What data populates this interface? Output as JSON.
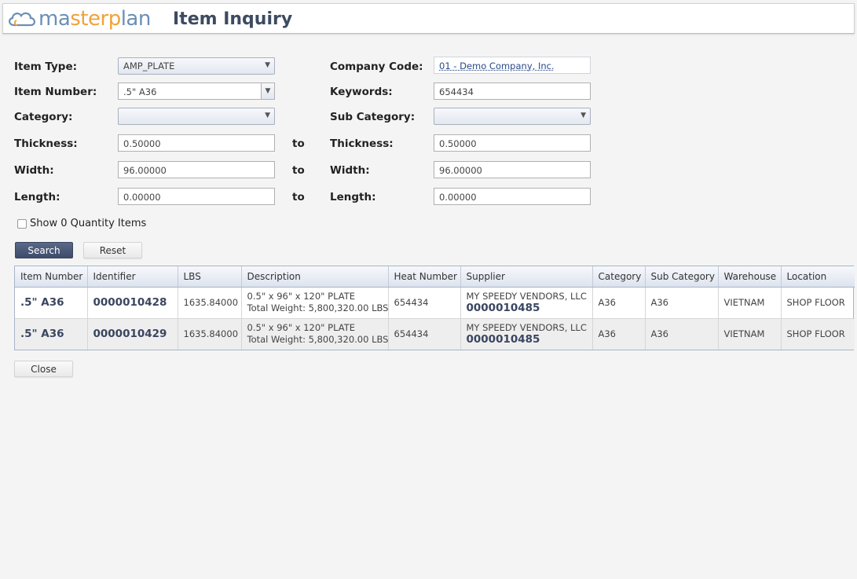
{
  "brand": {
    "logo_part1": "ma",
    "logo_part2": "sterp",
    "logo_part3": "lan",
    "colors": {
      "blue": "#6b8fb5",
      "orange": "#f0a23a"
    }
  },
  "page": {
    "title": "Item Inquiry"
  },
  "form": {
    "item_type": {
      "label": "Item Type:",
      "value": "AMP_PLATE"
    },
    "item_number": {
      "label": "Item Number:",
      "value": ".5\" A36"
    },
    "category": {
      "label": "Category:",
      "value": ""
    },
    "thickness_from": {
      "label": "Thickness:",
      "value": "0.50000"
    },
    "width_from": {
      "label": "Width:",
      "value": "96.00000"
    },
    "length_from": {
      "label": "Length:",
      "value": "0.00000"
    },
    "to_label": "to",
    "company_code": {
      "label": "Company Code:",
      "value": "01 - Demo Company, Inc."
    },
    "keywords": {
      "label": "Keywords:",
      "value": "654434"
    },
    "sub_category": {
      "label": "Sub Category:",
      "value": ""
    },
    "thickness_to": {
      "label": "Thickness:",
      "value": "0.50000"
    },
    "width_to": {
      "label": "Width:",
      "value": "96.00000"
    },
    "length_to": {
      "label": "Length:",
      "value": "0.00000"
    },
    "show_zero_qty": {
      "label": "Show 0 Quantity Items",
      "checked": false
    }
  },
  "buttons": {
    "search": "Search",
    "reset": "Reset",
    "close": "Close"
  },
  "table": {
    "columns": [
      "Item Number",
      "Identifier",
      "LBS",
      "Description",
      "Heat Number",
      "Supplier",
      "Category",
      "Sub Category",
      "Warehouse",
      "Location"
    ],
    "rows": [
      {
        "item_number": ".5\" A36",
        "identifier": "0000010428",
        "lbs": "1635.84000",
        "desc_line1": "0.5\" x 96\" x 120\" PLATE",
        "desc_line2": "Total Weight: 5,800,320.00 LBS",
        "heat_number": "654434",
        "supplier_name": "MY SPEEDY VENDORS, LLC",
        "supplier_id": "0000010485",
        "category": "A36",
        "sub_category": "A36",
        "warehouse": "VIETNAM",
        "location": "SHOP FLOOR"
      },
      {
        "item_number": ".5\" A36",
        "identifier": "0000010429",
        "lbs": "1635.84000",
        "desc_line1": "0.5\" x 96\" x 120\" PLATE",
        "desc_line2": "Total Weight: 5,800,320.00 LBS",
        "heat_number": "654434",
        "supplier_name": "MY SPEEDY VENDORS, LLC",
        "supplier_id": "0000010485",
        "category": "A36",
        "sub_category": "A36",
        "warehouse": "VIETNAM",
        "location": "SHOP FLOOR"
      }
    ]
  }
}
